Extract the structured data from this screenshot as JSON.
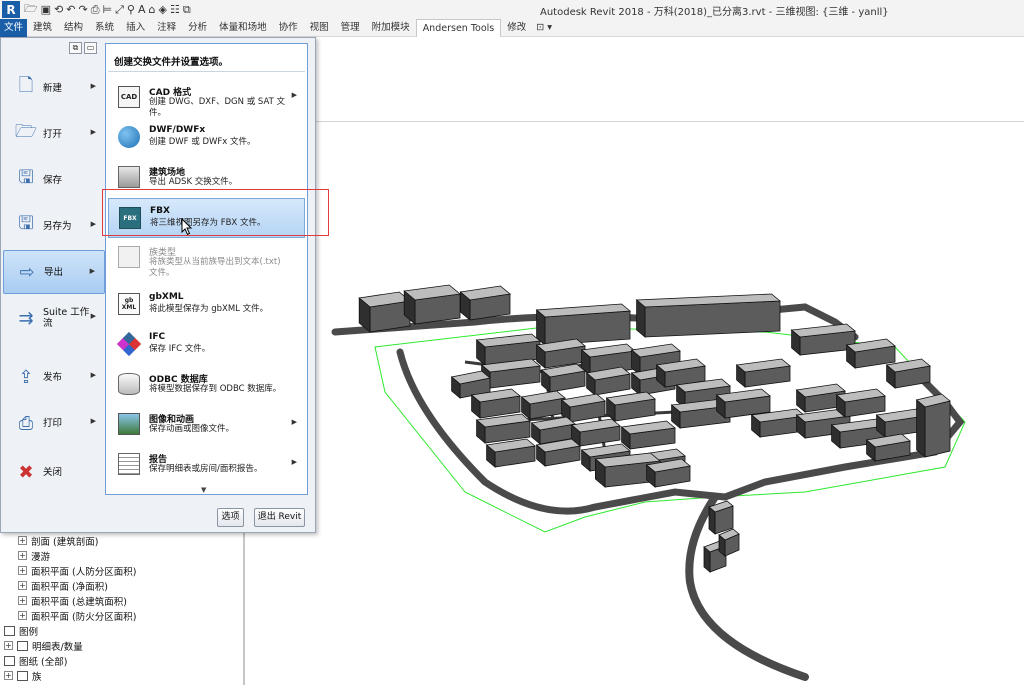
{
  "window": {
    "title": "Autodesk Revit 2018 -    万科(2018)_已分离3.rvt - 三维视图: {三维 - yanll}",
    "app_logo": "R"
  },
  "quick_access": [
    "folder-open-icon",
    "save-icon",
    "sync-icon",
    "undo-icon",
    "redo-icon",
    "print-icon",
    "measure-icon",
    "dimension-icon",
    "tag-icon",
    "text-icon",
    "view-3d-icon",
    "section-icon",
    "close-views-icon",
    "switch-windows-icon"
  ],
  "ribbon": {
    "tabs": [
      "文件",
      "建筑",
      "结构",
      "系统",
      "插入",
      "注释",
      "分析",
      "体量和场地",
      "协作",
      "视图",
      "管理",
      "附加模块",
      "Andersen Tools",
      "修改",
      "⊡ ▾"
    ]
  },
  "app_menu": {
    "left_items": [
      {
        "label": "新建",
        "icon": "new-doc-icon",
        "has_arrow": true
      },
      {
        "label": "打开",
        "icon": "open-folder-icon",
        "has_arrow": true
      },
      {
        "label": "保存",
        "icon": "save-icon",
        "has_arrow": false
      },
      {
        "label": "另存为",
        "icon": "save-as-icon",
        "has_arrow": true
      },
      {
        "label": "导出",
        "icon": "export-icon",
        "has_arrow": true
      },
      {
        "label": "Suite 工作流",
        "icon": "suite-workflow-icon",
        "has_arrow": true
      },
      {
        "label": "发布",
        "icon": "publish-icon",
        "has_arrow": true
      },
      {
        "label": "打印",
        "icon": "printer-icon",
        "has_arrow": true
      },
      {
        "label": "关闭",
        "icon": "close-doc-icon",
        "has_arrow": false
      }
    ],
    "active_left": "导出",
    "submenu": {
      "title": "创建交换文件并设置选项。",
      "items": [
        {
          "title": "CAD 格式",
          "desc": "创建 DWG、DXF、DGN 或 SAT 文件。",
          "icon": "cad-icon",
          "icon_text": "CAD",
          "arrow": true
        },
        {
          "title": "DWF/DWFx",
          "desc": "创建 DWF 或 DWFx 文件。",
          "icon": "globe-icon",
          "icon_text": "",
          "arrow": false
        },
        {
          "title": "建筑场地",
          "desc": "导出 ADSK 交换文件。",
          "icon": "building-site-icon",
          "icon_text": "",
          "arrow": false
        },
        {
          "title": "FBX",
          "desc": "将三维视图另存为 FBX 文件。",
          "icon": "fbx-icon",
          "icon_text": "FBX",
          "arrow": false
        },
        {
          "title": "族类型",
          "desc": "将族类型从当前族导出到文本(.txt)文件。",
          "icon": "family-types-icon",
          "icon_text": "",
          "arrow": false
        },
        {
          "title": "gbXML",
          "desc": "将此模型保存为 gbXML 文件。",
          "icon": "gbxml-icon",
          "icon_text": "gb XML",
          "arrow": false
        },
        {
          "title": "IFC",
          "desc": "保存 IFC 文件。",
          "icon": "ifc-icon",
          "icon_text": "",
          "arrow": false
        },
        {
          "title": "ODBC 数据库",
          "desc": "将模型数据保存到 ODBC 数据库。",
          "icon": "database-icon",
          "icon_text": "",
          "arrow": false
        },
        {
          "title": "图像和动画",
          "desc": "保存动画或图像文件。",
          "icon": "image-animation-icon",
          "icon_text": "",
          "arrow": true
        },
        {
          "title": "报告",
          "desc": "保存明细表或房间/面积报告。",
          "icon": "report-icon",
          "icon_text": "",
          "arrow": true
        }
      ],
      "highlighted": "FBX",
      "disabled": "族类型"
    },
    "buttons": {
      "options": "选项",
      "exit": "退出 Revit"
    }
  },
  "project_browser": {
    "items": [
      {
        "label": "剖面 (建筑剖面)",
        "toggle": "+",
        "level": 1
      },
      {
        "label": "漫游",
        "toggle": "+",
        "level": 1
      },
      {
        "label": "面积平面 (人防分区面积)",
        "toggle": "+",
        "level": 1
      },
      {
        "label": "面积平面 (净面积)",
        "toggle": "+",
        "level": 1
      },
      {
        "label": "面积平面 (总建筑面积)",
        "toggle": "+",
        "level": 1
      },
      {
        "label": "面积平面 (防火分区面积)",
        "toggle": "+",
        "level": 1
      },
      {
        "label": "图例",
        "toggle": "",
        "level": 0
      },
      {
        "label": "明细表/数量",
        "toggle": "+",
        "level": 0
      },
      {
        "label": "图纸 (全部)",
        "toggle": "",
        "level": 0
      },
      {
        "label": "族",
        "toggle": "+",
        "level": 0
      }
    ]
  },
  "colors": {
    "file_tab": "#1a5ea8",
    "highlight": "#b5d4f4",
    "annotation_box": "#e23b3b",
    "building": "#5c5c5c",
    "road": "#4a4a4a",
    "site_line": "#2ee82e"
  }
}
